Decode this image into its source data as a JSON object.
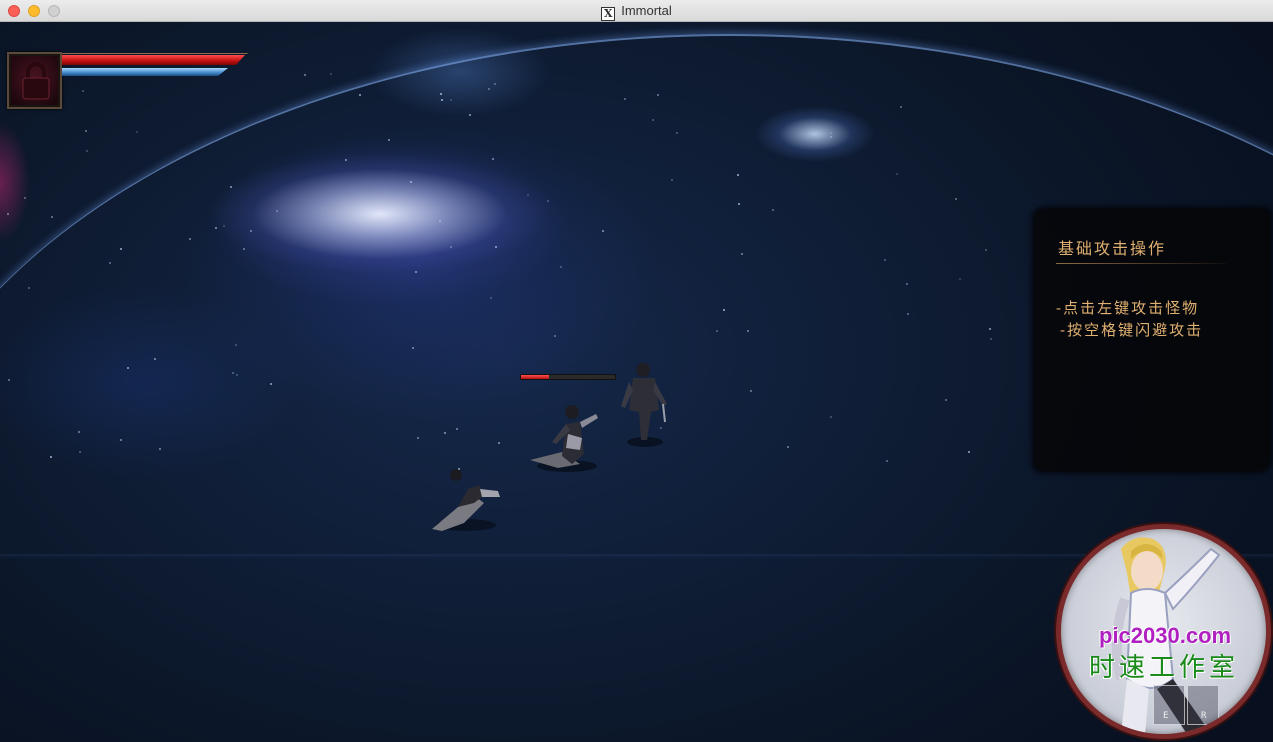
{
  "window": {
    "title": "Immortal",
    "app_icon_glyph": "X"
  },
  "hud": {
    "avatar_icon": "lock-icon",
    "hp_fraction": 1.0,
    "mp_fraction": 1.0,
    "hp_color": "#d01818",
    "mp_color": "#4a90d0"
  },
  "enemy": {
    "hp_fraction": 0.3
  },
  "tutorial": {
    "title": "基础攻击操作",
    "lines": [
      "-点击左键攻击怪物",
      "-按空格键闪避攻击"
    ],
    "text_color": "#e0b070"
  },
  "watermark": {
    "site": "pic2030.com",
    "studio": "时速工作室",
    "keys": [
      "E",
      "R"
    ]
  }
}
